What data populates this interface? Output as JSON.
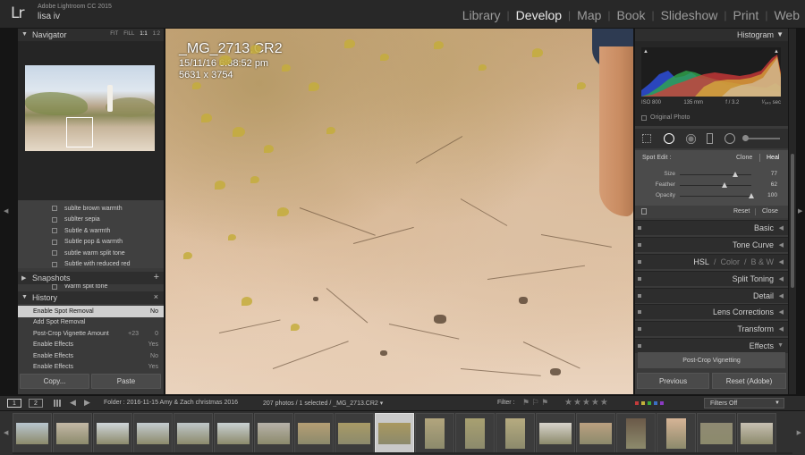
{
  "app": {
    "title": "Adobe Lightroom CC 2015",
    "user": "lisa iv",
    "logo": "Lr"
  },
  "modules": [
    {
      "label": "Library",
      "active": false
    },
    {
      "label": "Develop",
      "active": true
    },
    {
      "label": "Map",
      "active": false
    },
    {
      "label": "Book",
      "active": false
    },
    {
      "label": "Slideshow",
      "active": false
    },
    {
      "label": "Print",
      "active": false
    },
    {
      "label": "Web",
      "active": false
    }
  ],
  "navigator": {
    "title": "Navigator",
    "zoom": [
      "FIT",
      "FILL",
      "1:1",
      "1:2"
    ],
    "zoom_active": "1:1"
  },
  "presets": [
    "sublte brown warmth",
    "sublter sepia",
    "Subtle & warmth",
    "Subtle pop & warmth",
    "subtle warm split tone",
    "Subtle with reduced red",
    "undo SDM3 calibration",
    "Warm split tone"
  ],
  "snapshots": {
    "title": "Snapshots",
    "add": "+"
  },
  "history": {
    "title": "History",
    "clear": "×",
    "rows": [
      {
        "name": "Enable Spot Removal",
        "v1": "",
        "v2": "No",
        "selected": true
      },
      {
        "name": "Add Spot Removal",
        "v1": "",
        "v2": "",
        "selected": false
      },
      {
        "name": "Post-Crop Vignette Amount",
        "v1": "+23",
        "v2": "0",
        "selected": false
      },
      {
        "name": "Enable Effects",
        "v1": "",
        "v2": "Yes",
        "selected": false
      },
      {
        "name": "Enable Effects",
        "v1": "",
        "v2": "No",
        "selected": false
      },
      {
        "name": "Enable Effects",
        "v1": "",
        "v2": "Yes",
        "selected": false
      }
    ]
  },
  "left_buttons": {
    "copy": "Copy...",
    "paste": "Paste"
  },
  "image_info": {
    "filename": "_MG_2713.CR2",
    "date": "15/11/16 6:38:52 pm",
    "size": "5631 x 3754"
  },
  "histogram": {
    "title": "Histogram",
    "iso": "ISO 800",
    "focal": "135 mm",
    "aperture": "f / 3.2",
    "shutter": "¹⁄₆₄₀ sec",
    "original_photo": "Original Photo"
  },
  "spot_edit": {
    "label": "Spot Edit :",
    "clone": "Clone",
    "heal": "Heal",
    "active_mode": "Heal",
    "sliders": [
      {
        "label": "Size",
        "value": "77",
        "fraction": 0.77
      },
      {
        "label": "Feather",
        "value": "62",
        "fraction": 0.62
      },
      {
        "label": "Opacity",
        "value": "100",
        "fraction": 1.0
      }
    ],
    "reset": "Reset",
    "close": "Close"
  },
  "sections": [
    {
      "name": "basic",
      "title": "Basic"
    },
    {
      "name": "tone-curve",
      "title": "Tone Curve"
    },
    {
      "name": "split-toning",
      "title": "Split Toning"
    },
    {
      "name": "detail",
      "title": "Detail"
    },
    {
      "name": "lens-corrections",
      "title": "Lens Corrections"
    },
    {
      "name": "transform",
      "title": "Transform"
    },
    {
      "name": "effects",
      "title": "Effects"
    }
  ],
  "hsl_tabs": [
    "HSL",
    "Color",
    "B & W"
  ],
  "hsl_sep": "/",
  "post_crop_vignetting": "Post-Crop Vignetting",
  "right_buttons": {
    "previous": "Previous",
    "reset": "Reset (Adobe)"
  },
  "filmstrip_toolbar": {
    "screen1": "1",
    "screen2": "2",
    "folder": "Folder : 2016-11-15 Amy & Zach christmas 2016",
    "count": "207 photos / 1 selected / _MG_2713.CR2 ▾",
    "filter": "Filter :",
    "filters_off": "Filters Off",
    "stars": "★★★★★",
    "flags": "⚑ ⚐ ⚑",
    "color_labels": [
      "#c23b3b",
      "#c2b23b",
      "#3bab3b",
      "#3b6fc2",
      "#8b3bc2"
    ]
  },
  "filmstrip": {
    "selected_index": 9,
    "thumbs": [
      {
        "tone": "#b9c6cf",
        "portrait": false
      },
      {
        "tone": "#c3b9a6",
        "portrait": false
      },
      {
        "tone": "#cfd6da",
        "portrait": false
      },
      {
        "tone": "#c4ccd0",
        "portrait": false
      },
      {
        "tone": "#bfc7c9",
        "portrait": false
      },
      {
        "tone": "#c9d1d3",
        "portrait": false
      },
      {
        "tone": "#b7b2a9",
        "portrait": false
      },
      {
        "tone": "#b59e74",
        "portrait": false
      },
      {
        "tone": "#a89a66",
        "portrait": false
      },
      {
        "tone": "#a9985f",
        "portrait": false
      },
      {
        "tone": "#b2a57d",
        "portrait": true
      },
      {
        "tone": "#a8a071",
        "portrait": true
      },
      {
        "tone": "#b6ab80",
        "portrait": true
      },
      {
        "tone": "#d8d4cc",
        "portrait": false
      },
      {
        "tone": "#bba080",
        "portrait": false
      },
      {
        "tone": "#6a5948",
        "portrait": true
      },
      {
        "tone": "#d6b496",
        "portrait": true
      },
      {
        "tone": "#8f8a73",
        "portrait": false
      },
      {
        "tone": "#c7c0b2",
        "portrait": false
      }
    ]
  }
}
